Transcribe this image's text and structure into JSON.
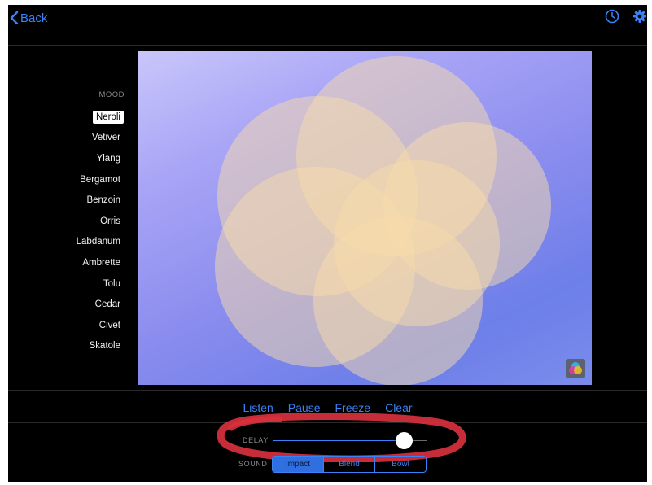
{
  "nav": {
    "back_label": "Back",
    "history_icon": "clock-icon",
    "settings_icon": "gear-icon"
  },
  "mood": {
    "title": "MOOD",
    "selected": "Neroli",
    "items": [
      "Neroli",
      "Vetiver",
      "Ylang",
      "Bergamot",
      "Benzoin",
      "Orris",
      "Labdanum",
      "Ambrette",
      "Tolu",
      "Cedar",
      "Civet",
      "Skatole"
    ]
  },
  "canvas": {
    "palette_icon": "color-palette-icon"
  },
  "actions": {
    "listen": "Listen",
    "pause": "Pause",
    "freeze": "Freeze",
    "clear": "Clear"
  },
  "delay": {
    "label": "DELAY",
    "value": 0.85
  },
  "sound": {
    "label": "SOUND",
    "options": [
      "Impact",
      "Blend",
      "Bowl"
    ],
    "selected": "Impact"
  },
  "colors": {
    "accent": "#3b82f6",
    "annotation": "#d8313d",
    "background": "#000000"
  }
}
